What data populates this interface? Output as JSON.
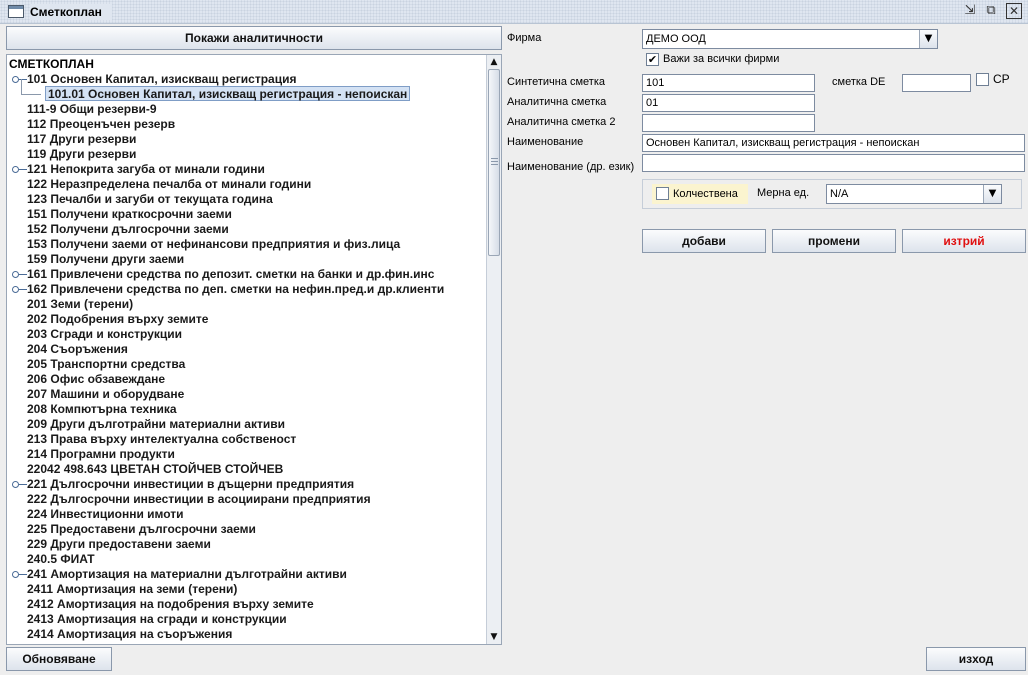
{
  "window": {
    "title": "Сметкоплан",
    "controls": [
      "restore-icon",
      "maximize-icon",
      "close-icon"
    ]
  },
  "left": {
    "show_analytics_label": "Покажи аналитичности",
    "refresh_label": "Обновяване",
    "tree": {
      "root_label": "СМЕТКОПЛАН",
      "items": [
        {
          "label": "101 Основен Капитал, изискващ регистрация",
          "expandable": true
        },
        {
          "label": "101.01 Основен Капитал, изискващ регистрация - непоискан",
          "child": true,
          "selected": true
        },
        {
          "label": "111-9 Общи резерви-9"
        },
        {
          "label": "112 Преоценъчен резерв"
        },
        {
          "label": "117 Други резерви"
        },
        {
          "label": "119 Други резерви"
        },
        {
          "label": "121 Непокрита загуба от минали години",
          "expandable": true
        },
        {
          "label": "122 Неразпределена печалба от минали години"
        },
        {
          "label": "123 Печалби и загуби от текущата година"
        },
        {
          "label": "151 Получени краткосрочни заеми"
        },
        {
          "label": "152 Получени дългосрочни заеми"
        },
        {
          "label": "153 Получени заеми от нефинансови предприятия и физ.лица"
        },
        {
          "label": "159 Получени други заеми"
        },
        {
          "label": "161 Привлечени средства по депозит. сметки на банки и др.фин.инс",
          "expandable": true
        },
        {
          "label": "162 Привлечени средства по деп. сметки на нефин.пред.и др.клиенти",
          "expandable": true
        },
        {
          "label": "201 Земи (терени)"
        },
        {
          "label": "202 Подобрения върху земите"
        },
        {
          "label": "203 Сгради и конструкции"
        },
        {
          "label": "204 Съоръжения"
        },
        {
          "label": "205 Транспортни средства"
        },
        {
          "label": "206 Офис обзавеждане"
        },
        {
          "label": "207 Машини и оборудване"
        },
        {
          "label": "208 Компютърна техника"
        },
        {
          "label": "209 Други дълготрайни материални активи"
        },
        {
          "label": "213 Права върху интелектуална собственост"
        },
        {
          "label": "214 Програмни продукти"
        },
        {
          "label": "22042 498.643 ЦВЕТАН СТОЙЧЕВ СТОЙЧЕВ"
        },
        {
          "label": "221 Дългосрочни инвестиции в дъщерни предприятия",
          "expandable": true
        },
        {
          "label": "222 Дългосрочни инвестиции в асоциирани предприятия"
        },
        {
          "label": "224 Инвестиционни имоти"
        },
        {
          "label": "225 Предоставени дългосрочни заеми"
        },
        {
          "label": "229 Други предоставени заеми"
        },
        {
          "label": "240.5 ФИАТ"
        },
        {
          "label": "241 Амортизация на материални дълготрайни активи",
          "expandable": true
        },
        {
          "label": "2411 Амортизация на земи (терени)"
        },
        {
          "label": "2412 Амортизация на подобрения върху земите"
        },
        {
          "label": "2413 Амортизация на сгради и конструкции"
        },
        {
          "label": "2414 Амортизация на съоръжения"
        }
      ]
    }
  },
  "form": {
    "firm_label": "Фирма",
    "firm_value": "ДЕМО ООД",
    "all_firms_label": "Важи за всички фирми",
    "all_firms_checked": "✔",
    "synthetic_label": "Синтетична сметка",
    "synthetic_value": "101",
    "account_de_label": "сметка DE",
    "account_de_value": "",
    "cp_label": "CP",
    "analytic_label": "Аналитична сметка",
    "analytic_value": "01",
    "analytic2_label": "Аналитична сметка 2",
    "analytic2_value": "",
    "name_label": "Наименование",
    "name_value": "Основен Капитал, изискващ регистрация - непоискан",
    "name_other_label": "Наименование (др. език)",
    "name_other_value": "",
    "quantitative_label": "Колчествена",
    "unit_label": "Мерна ед.",
    "unit_value": "N/A"
  },
  "actions": {
    "add_label": "добави",
    "change_label": "промени",
    "delete_label": "изтрий",
    "exit_label": "изход",
    "delete_color": "#e01010"
  }
}
